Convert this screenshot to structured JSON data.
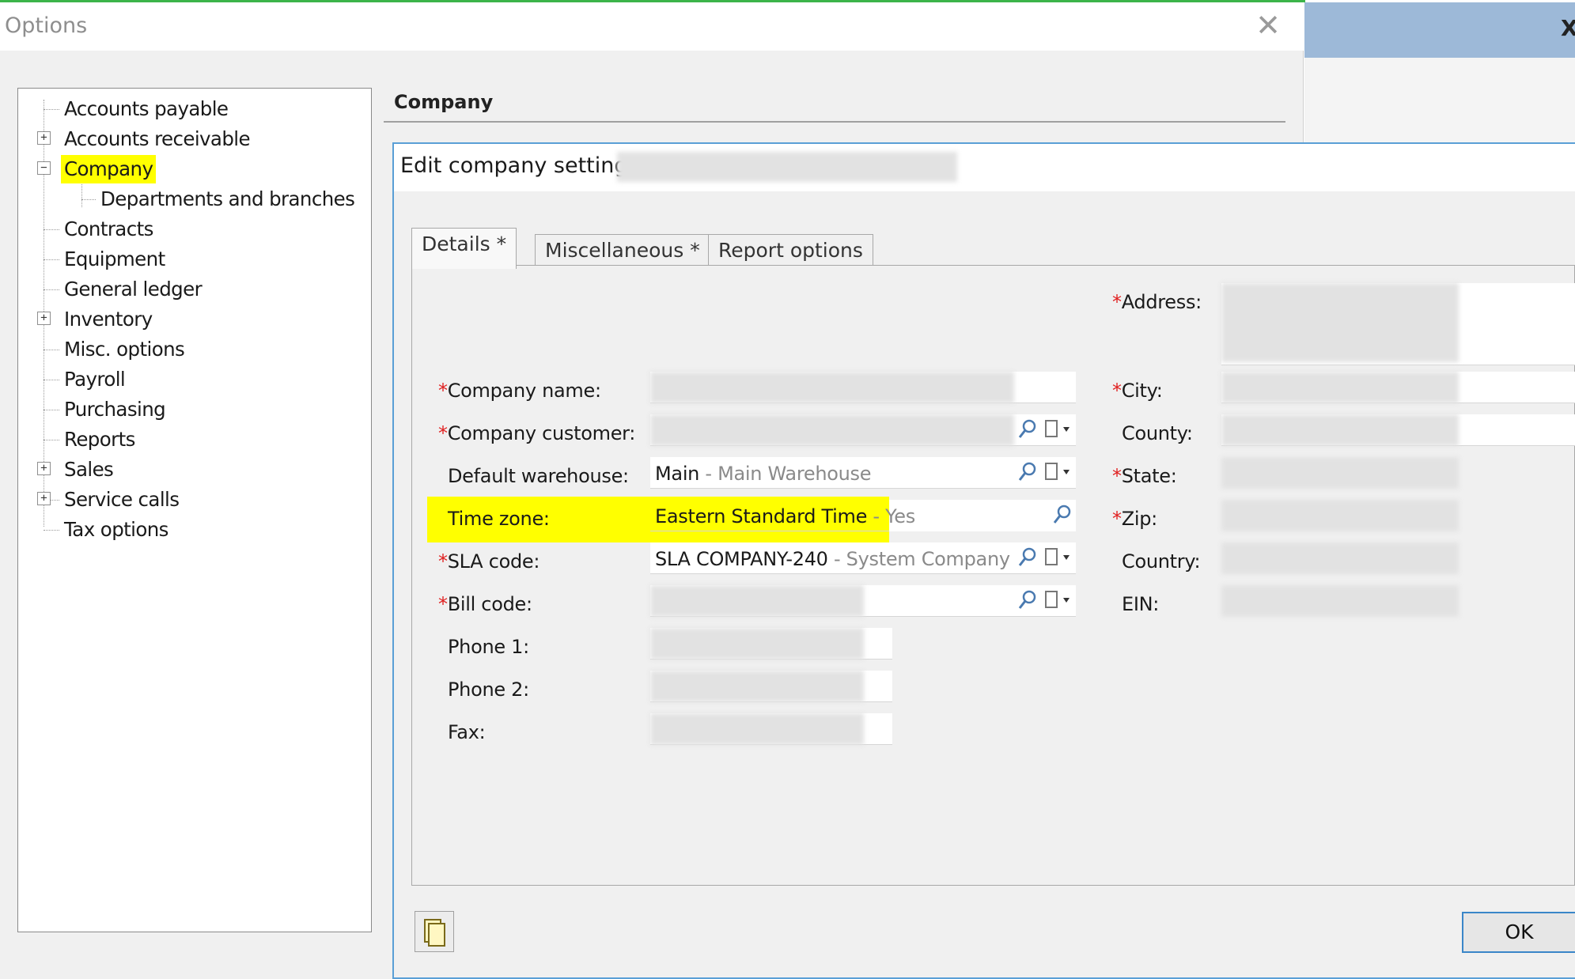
{
  "options_window": {
    "title": "Options"
  },
  "tree": {
    "items": [
      {
        "label": "Accounts payable"
      },
      {
        "label": "Accounts receivable"
      },
      {
        "label": "Company"
      },
      {
        "label": "Departments and branches"
      },
      {
        "label": "Contracts"
      },
      {
        "label": "Equipment"
      },
      {
        "label": "General ledger"
      },
      {
        "label": "Inventory"
      },
      {
        "label": "Misc. options"
      },
      {
        "label": "Payroll"
      },
      {
        "label": "Purchasing"
      },
      {
        "label": "Reports"
      },
      {
        "label": "Sales"
      },
      {
        "label": "Service calls"
      },
      {
        "label": "Tax options"
      }
    ]
  },
  "company_panel": {
    "header": "Company"
  },
  "dialog": {
    "title": "Edit company settings",
    "tabs": [
      {
        "label": "Details *"
      },
      {
        "label": "Miscellaneous *"
      },
      {
        "label": "Report options"
      }
    ],
    "required_marker": "*",
    "left_fields": {
      "company_name": {
        "label": "Company name:"
      },
      "company_customer": {
        "label": "Company customer:"
      },
      "default_warehouse": {
        "label": "Default warehouse:",
        "value": "Main",
        "sub": " - Main Warehouse"
      },
      "time_zone": {
        "label": "Time zone:",
        "value": "Eastern Standard Time",
        "sub": " - Yes"
      },
      "sla_code": {
        "label": "SLA code:",
        "value": "SLA COMPANY-240",
        "sub": " - System Company"
      },
      "bill_code": {
        "label": "Bill code:"
      },
      "phone1": {
        "label": "Phone 1:"
      },
      "phone2": {
        "label": "Phone 2:"
      },
      "fax": {
        "label": "Fax:"
      }
    },
    "right_fields": {
      "address": {
        "label": "Address:"
      },
      "city": {
        "label": "City:"
      },
      "county": {
        "label": "County:"
      },
      "state": {
        "label": "State:"
      },
      "zip": {
        "label": "Zip:"
      },
      "country": {
        "label": "Country:"
      },
      "ein": {
        "label": "EIN:"
      }
    },
    "ok_label": "OK"
  },
  "colors": {
    "highlight": "#ffff00",
    "required": "#e02020",
    "dialog_border": "#5a9fd6",
    "background_window_title": "#9db9d8"
  },
  "icons": [
    "close-icon",
    "expand-icon",
    "collapse-icon",
    "magnifier-icon",
    "dropdown-menu-icon",
    "page-icon"
  ]
}
